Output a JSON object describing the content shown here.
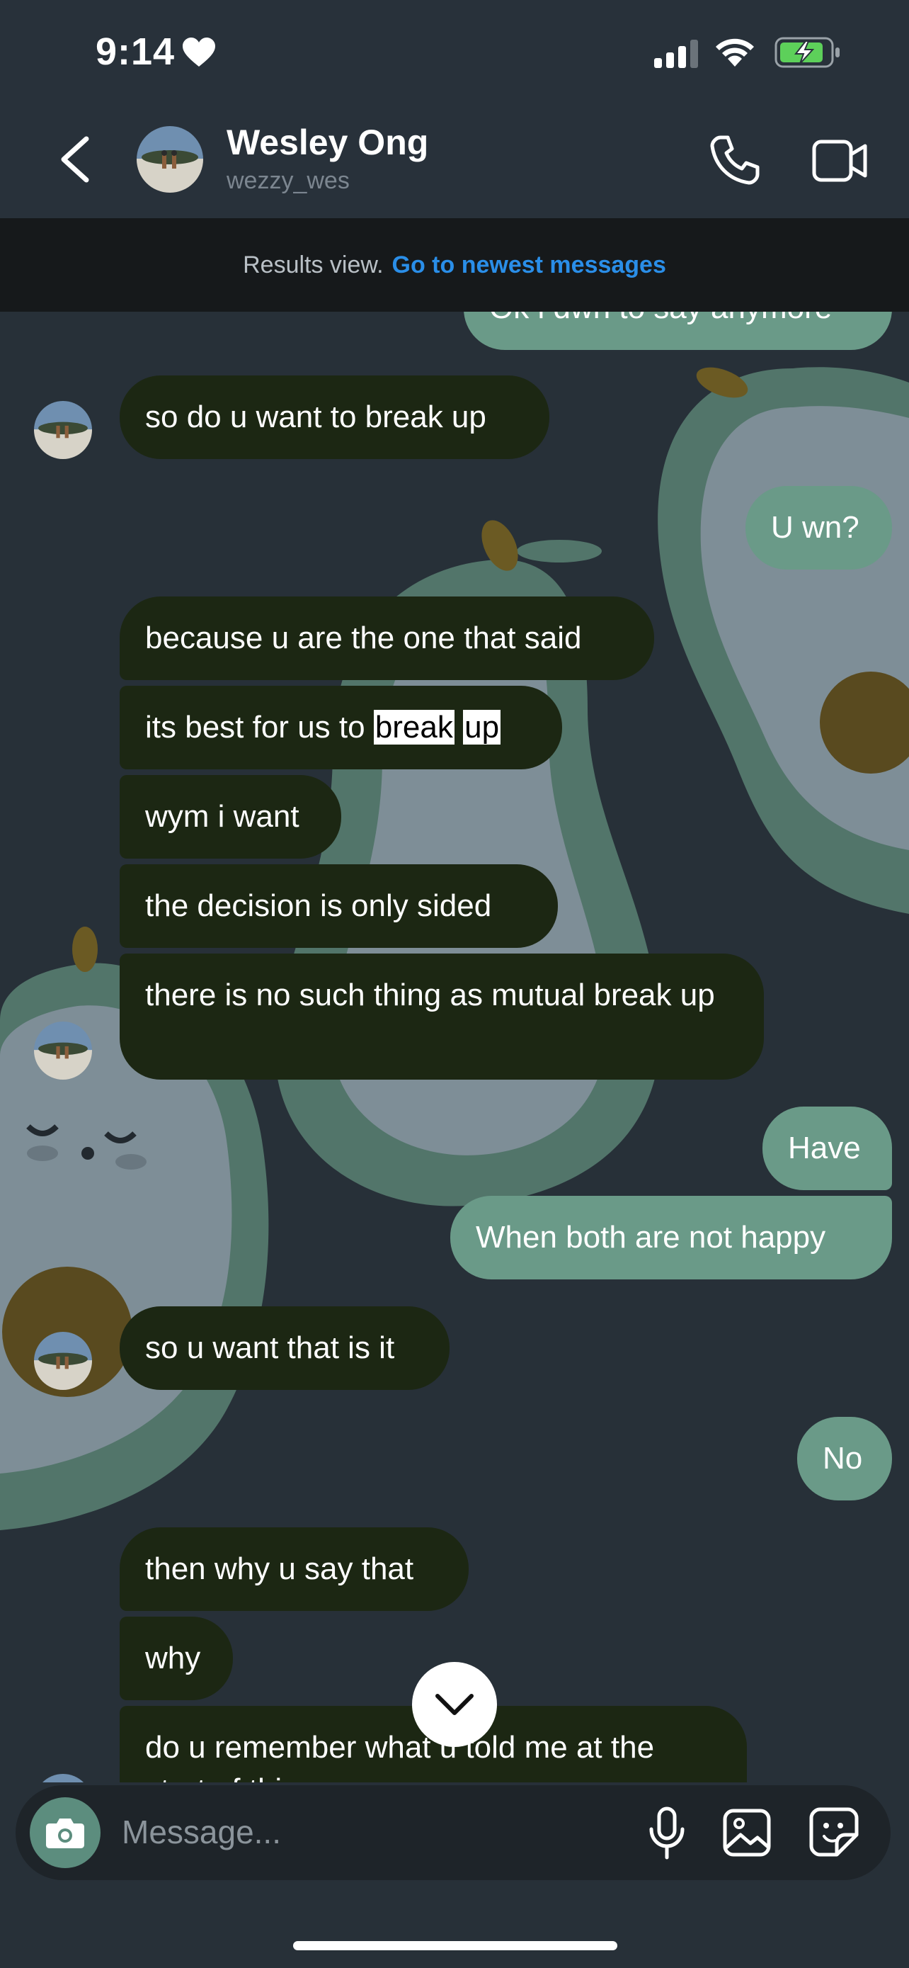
{
  "status_bar": {
    "time": "9:14",
    "heart_icon": "heart-icon",
    "signal_icon": "cellular-signal-icon",
    "wifi_icon": "wifi-icon",
    "battery_icon": "battery-charging-icon"
  },
  "header": {
    "name": "Wesley Ong",
    "username": "wezzy_wes",
    "back_icon": "chevron-left-icon",
    "call_icon": "phone-icon",
    "video_icon": "video-camera-icon"
  },
  "banner": {
    "text": "Results view.",
    "link": "Go to newest messages"
  },
  "messages": [
    {
      "side": "out",
      "text": "Ok i dwn to say anymore"
    },
    {
      "side": "in",
      "text": "so do u want to break up"
    },
    {
      "side": "out",
      "text": "U wn?"
    },
    {
      "side": "in",
      "text": "because u are the one that said"
    },
    {
      "side": "in",
      "text_before": "its best for us to",
      "highlight_1": "break",
      "highlight_2": "up"
    },
    {
      "side": "in",
      "text": "wym i want"
    },
    {
      "side": "in",
      "text": "the decision is only sided"
    },
    {
      "side": "in",
      "text": "there is no such thing as mutual break up"
    },
    {
      "side": "out",
      "text": "Have"
    },
    {
      "side": "out",
      "text": "When both are not happy"
    },
    {
      "side": "in",
      "text": "so u want that is it"
    },
    {
      "side": "out",
      "text": "No"
    },
    {
      "side": "in",
      "text": "then why u say that"
    },
    {
      "side": "in",
      "text": "why"
    },
    {
      "side": "in",
      "text": "do u remember what u told me at the start of this year"
    }
  ],
  "scroll_button": {
    "icon": "chevron-down-icon"
  },
  "composer": {
    "placeholder": "Message...",
    "camera_icon": "camera-icon",
    "mic_icon": "microphone-icon",
    "gallery_icon": "gallery-icon",
    "sticker_icon": "sticker-icon"
  },
  "colors": {
    "background": "#273038",
    "incoming_bubble": "#1c2713",
    "outgoing_bubble": "#6a9a88",
    "link": "#2a8ee8"
  }
}
